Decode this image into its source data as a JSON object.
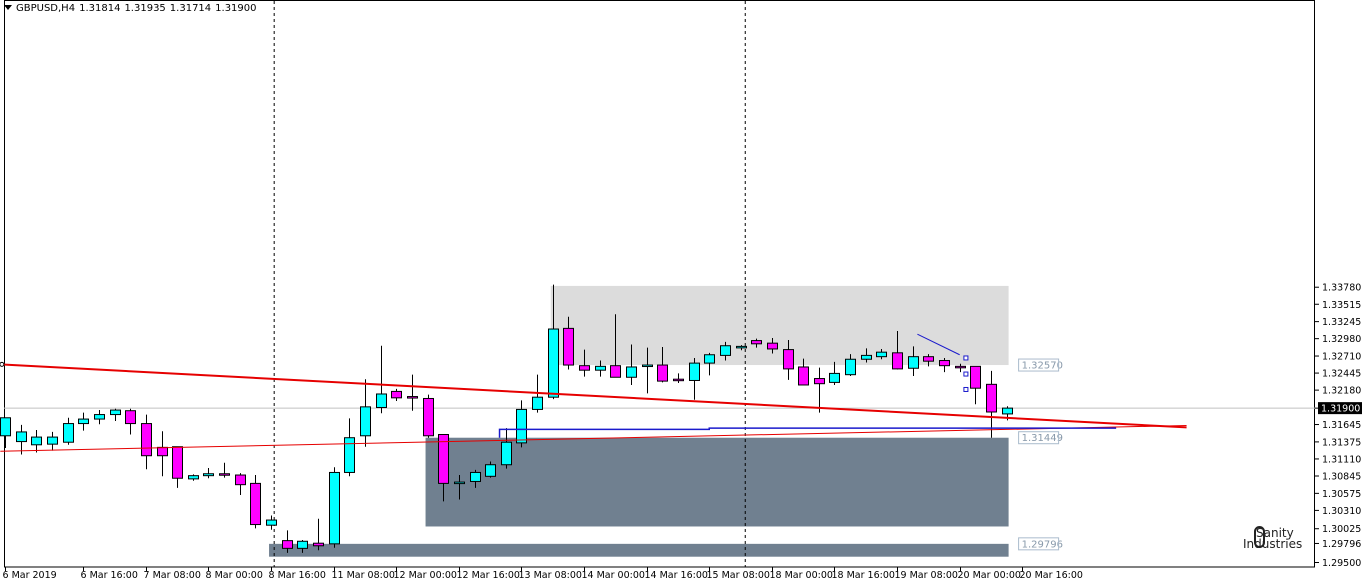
{
  "header": {
    "symbol": "GBPUSD,H4",
    "open": "1.31814",
    "high": "1.31935",
    "low": "1.31714",
    "close": "1.31900"
  },
  "logo": {
    "line1": "Sanity",
    "line2": "Industries"
  },
  "colors": {
    "bull_body": "#00ffff",
    "bear_body": "#ff00ff",
    "supply_zone": "#dcdcdc",
    "demand_zone": "#708090",
    "trendline": "#e60000",
    "level_line": "#1a1acc",
    "grid_marker": "#000000"
  },
  "chart_data": {
    "type": "candlestick",
    "symbol": "GBPUSD",
    "timeframe": "H4",
    "ylim": [
      1.2943,
      1.3795
    ],
    "y_ticks": [
      "1.29500",
      "1.29796",
      "1.30025",
      "1.30310",
      "1.30575",
      "1.30845",
      "1.31110",
      "1.31375",
      "1.31645",
      "1.31900",
      "1.32180",
      "1.32445",
      "1.32710",
      "1.32980",
      "1.33245",
      "1.33515",
      "1.33780"
    ],
    "x_ticks": [
      {
        "label": "6 Mar 2019",
        "bar": 0
      },
      {
        "label": "6 Mar 16:00",
        "bar": 5
      },
      {
        "label": "7 Mar 08:00",
        "bar": 9
      },
      {
        "label": "8 Mar 00:00",
        "bar": 13
      },
      {
        "label": "8 Mar 16:00",
        "bar": 17
      },
      {
        "label": "11 Mar 08:00",
        "bar": 21
      },
      {
        "label": "12 Mar 00:00",
        "bar": 25
      },
      {
        "label": "12 Mar 16:00",
        "bar": 29
      },
      {
        "label": "13 Mar 08:00",
        "bar": 33
      },
      {
        "label": "14 Mar 00:00",
        "bar": 37
      },
      {
        "label": "14 Mar 16:00",
        "bar": 41
      },
      {
        "label": "15 Mar 08:00",
        "bar": 45
      },
      {
        "label": "18 Mar 00:00",
        "bar": 49
      },
      {
        "label": "18 Mar 16:00",
        "bar": 53
      },
      {
        "label": "19 Mar 08:00",
        "bar": 57
      },
      {
        "label": "20 Mar 00:00",
        "bar": 61
      },
      {
        "label": "20 Mar 16:00",
        "bar": 65
      }
    ],
    "current_price": "1.31900",
    "candles": [
      {
        "o": 1.3147,
        "h": 1.3172,
        "l": 1.3128,
        "c": 1.3175
      },
      {
        "o": 1.3138,
        "h": 1.3164,
        "l": 1.3118,
        "c": 1.3153
      },
      {
        "o": 1.3133,
        "h": 1.3156,
        "l": 1.3121,
        "c": 1.3145
      },
      {
        "o": 1.3134,
        "h": 1.3153,
        "l": 1.3124,
        "c": 1.3145
      },
      {
        "o": 1.3137,
        "h": 1.3175,
        "l": 1.3133,
        "c": 1.3166
      },
      {
        "o": 1.3166,
        "h": 1.3183,
        "l": 1.3155,
        "c": 1.3173
      },
      {
        "o": 1.3173,
        "h": 1.3187,
        "l": 1.3165,
        "c": 1.318
      },
      {
        "o": 1.318,
        "h": 1.3189,
        "l": 1.317,
        "c": 1.3187
      },
      {
        "o": 1.3186,
        "h": 1.3189,
        "l": 1.3149,
        "c": 1.3166
      },
      {
        "o": 1.3166,
        "h": 1.318,
        "l": 1.3095,
        "c": 1.3116
      },
      {
        "o": 1.3129,
        "h": 1.3154,
        "l": 1.3084,
        "c": 1.3116
      },
      {
        "o": 1.313,
        "h": 1.313,
        "l": 1.3066,
        "c": 1.3081
      },
      {
        "o": 1.308,
        "h": 1.3087,
        "l": 1.3077,
        "c": 1.3085
      },
      {
        "o": 1.3085,
        "h": 1.3097,
        "l": 1.3081,
        "c": 1.3088
      },
      {
        "o": 1.3088,
        "h": 1.3105,
        "l": 1.3082,
        "c": 1.3086
      },
      {
        "o": 1.3086,
        "h": 1.3089,
        "l": 1.3055,
        "c": 1.3071
      },
      {
        "o": 1.3073,
        "h": 1.3086,
        "l": 1.3003,
        "c": 1.3009
      },
      {
        "o": 1.3008,
        "h": 1.3023,
        "l": 1.3001,
        "c": 1.3016
      },
      {
        "o": 1.2984,
        "h": 1.3,
        "l": 1.2965,
        "c": 1.2972
      },
      {
        "o": 1.2972,
        "h": 1.2985,
        "l": 1.2965,
        "c": 1.2983
      },
      {
        "o": 1.298,
        "h": 1.3018,
        "l": 1.2969,
        "c": 1.2976
      },
      {
        "o": 1.2979,
        "h": 1.3098,
        "l": 1.2973,
        "c": 1.309
      },
      {
        "o": 1.309,
        "h": 1.3174,
        "l": 1.3084,
        "c": 1.3144
      },
      {
        "o": 1.3147,
        "h": 1.3235,
        "l": 1.313,
        "c": 1.3192
      },
      {
        "o": 1.3191,
        "h": 1.3287,
        "l": 1.3182,
        "c": 1.3212
      },
      {
        "o": 1.3216,
        "h": 1.322,
        "l": 1.3201,
        "c": 1.3206
      },
      {
        "o": 1.3208,
        "h": 1.3242,
        "l": 1.3186,
        "c": 1.3206
      },
      {
        "o": 1.3205,
        "h": 1.3211,
        "l": 1.3144,
        "c": 1.3147
      },
      {
        "o": 1.3149,
        "h": 1.3149,
        "l": 1.3045,
        "c": 1.3073
      },
      {
        "o": 1.3073,
        "h": 1.3086,
        "l": 1.3048,
        "c": 1.3075
      },
      {
        "o": 1.3076,
        "h": 1.3094,
        "l": 1.3066,
        "c": 1.309
      },
      {
        "o": 1.3084,
        "h": 1.3107,
        "l": 1.3082,
        "c": 1.3102
      },
      {
        "o": 1.3102,
        "h": 1.3159,
        "l": 1.3096,
        "c": 1.3137
      },
      {
        "o": 1.3136,
        "h": 1.3202,
        "l": 1.3129,
        "c": 1.3188
      },
      {
        "o": 1.3188,
        "h": 1.3242,
        "l": 1.3183,
        "c": 1.3207
      },
      {
        "o": 1.3207,
        "h": 1.3382,
        "l": 1.3204,
        "c": 1.3313
      },
      {
        "o": 1.3314,
        "h": 1.3332,
        "l": 1.325,
        "c": 1.3257
      },
      {
        "o": 1.3256,
        "h": 1.3281,
        "l": 1.3239,
        "c": 1.3249
      },
      {
        "o": 1.3249,
        "h": 1.3264,
        "l": 1.3239,
        "c": 1.3255
      },
      {
        "o": 1.3256,
        "h": 1.3336,
        "l": 1.324,
        "c": 1.3238
      },
      {
        "o": 1.3238,
        "h": 1.3289,
        "l": 1.3226,
        "c": 1.3254
      },
      {
        "o": 1.3257,
        "h": 1.3284,
        "l": 1.3213,
        "c": 1.3257
      },
      {
        "o": 1.3257,
        "h": 1.3285,
        "l": 1.323,
        "c": 1.3232
      },
      {
        "o": 1.3235,
        "h": 1.3244,
        "l": 1.3229,
        "c": 1.3233
      },
      {
        "o": 1.3233,
        "h": 1.3268,
        "l": 1.3203,
        "c": 1.326
      },
      {
        "o": 1.326,
        "h": 1.3276,
        "l": 1.3241,
        "c": 1.3273
      },
      {
        "o": 1.3272,
        "h": 1.3293,
        "l": 1.3264,
        "c": 1.3287
      },
      {
        "o": 1.3284,
        "h": 1.3288,
        "l": 1.328,
        "c": 1.3286
      },
      {
        "o": 1.3295,
        "h": 1.3298,
        "l": 1.3284,
        "c": 1.329
      },
      {
        "o": 1.3291,
        "h": 1.3299,
        "l": 1.3275,
        "c": 1.3282
      },
      {
        "o": 1.3281,
        "h": 1.3296,
        "l": 1.3234,
        "c": 1.3251
      },
      {
        "o": 1.3254,
        "h": 1.3267,
        "l": 1.3228,
        "c": 1.3226
      },
      {
        "o": 1.3236,
        "h": 1.3253,
        "l": 1.3183,
        "c": 1.3228
      },
      {
        "o": 1.323,
        "h": 1.3262,
        "l": 1.3226,
        "c": 1.3244
      },
      {
        "o": 1.3242,
        "h": 1.3274,
        "l": 1.324,
        "c": 1.3266
      },
      {
        "o": 1.3266,
        "h": 1.3283,
        "l": 1.3261,
        "c": 1.3272
      },
      {
        "o": 1.327,
        "h": 1.3282,
        "l": 1.3266,
        "c": 1.3277
      },
      {
        "o": 1.3276,
        "h": 1.331,
        "l": 1.325,
        "c": 1.3251
      },
      {
        "o": 1.3252,
        "h": 1.3286,
        "l": 1.324,
        "c": 1.327
      },
      {
        "o": 1.327,
        "h": 1.3274,
        "l": 1.3255,
        "c": 1.3263
      },
      {
        "o": 1.3264,
        "h": 1.3268,
        "l": 1.3246,
        "c": 1.3256
      },
      {
        "o": 1.3255,
        "h": 1.3259,
        "l": 1.3246,
        "c": 1.3254
      },
      {
        "o": 1.3255,
        "h": 1.3251,
        "l": 1.3196,
        "c": 1.3221
      },
      {
        "o": 1.3227,
        "h": 1.3248,
        "l": 1.3144,
        "c": 1.3184
      },
      {
        "o": 1.3181,
        "h": 1.3193,
        "l": 1.3171,
        "c": 1.319
      }
    ],
    "zones": [
      {
        "kind": "supply",
        "from_bar": 35,
        "to_bar": 64,
        "top": 1.338,
        "bottom": 1.3257,
        "label": "1.32570"
      },
      {
        "kind": "demand",
        "from_bar": 27,
        "to_bar": 64,
        "top": 1.3144,
        "bottom": 1.3006,
        "label": "1.31449"
      },
      {
        "kind": "demand",
        "from_bar": 17,
        "to_bar": 64,
        "top": 1.2979,
        "bottom": 1.2959,
        "label": "1.29796"
      }
    ],
    "trendlines": [
      {
        "name": "upper",
        "from": {
          "bar": -0.3,
          "price": 1.3258
        },
        "to": {
          "bar": 75.5,
          "price": 1.316
        }
      },
      {
        "name": "lower",
        "from": {
          "bar": -0.3,
          "price": 1.3123
        },
        "to": {
          "bar": 75.5,
          "price": 1.3163
        }
      }
    ],
    "level_line": {
      "from_bar": 31.6,
      "to_bar": 71,
      "price_start": 1.3157,
      "price_end": 1.3159
    },
    "vlines_bars": [
      17.2,
      47.3
    ]
  }
}
